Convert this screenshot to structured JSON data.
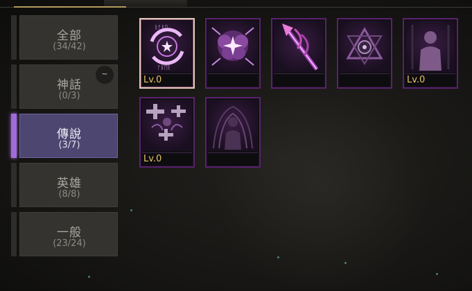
{
  "categories": [
    {
      "name": "全部",
      "count": "(34/42)"
    },
    {
      "name": "神話",
      "count": "(0/3)"
    },
    {
      "name": "傳說",
      "count": "(3/7)"
    },
    {
      "name": "英雄",
      "count": "(8/8)"
    },
    {
      "name": "一般",
      "count": "(23/24)"
    }
  ],
  "badge": "~",
  "skills": [
    {
      "icon": "rune-vortex-icon",
      "level": "Lv.0"
    },
    {
      "icon": "star-burst-icon",
      "level": ""
    },
    {
      "icon": "spear-strike-icon",
      "level": ""
    },
    {
      "icon": "triangle-sigil-icon",
      "level": ""
    },
    {
      "icon": "silhouette-icon",
      "level": "Lv.0"
    },
    {
      "icon": "healing-cross-icon",
      "level": "Lv.0"
    },
    {
      "icon": "dark-aura-icon",
      "level": ""
    }
  ],
  "colors": {
    "accent": "#a06cd8",
    "active_bg": "#4d4670",
    "frame": "#5a2170",
    "level_text": "#e8c46a"
  }
}
